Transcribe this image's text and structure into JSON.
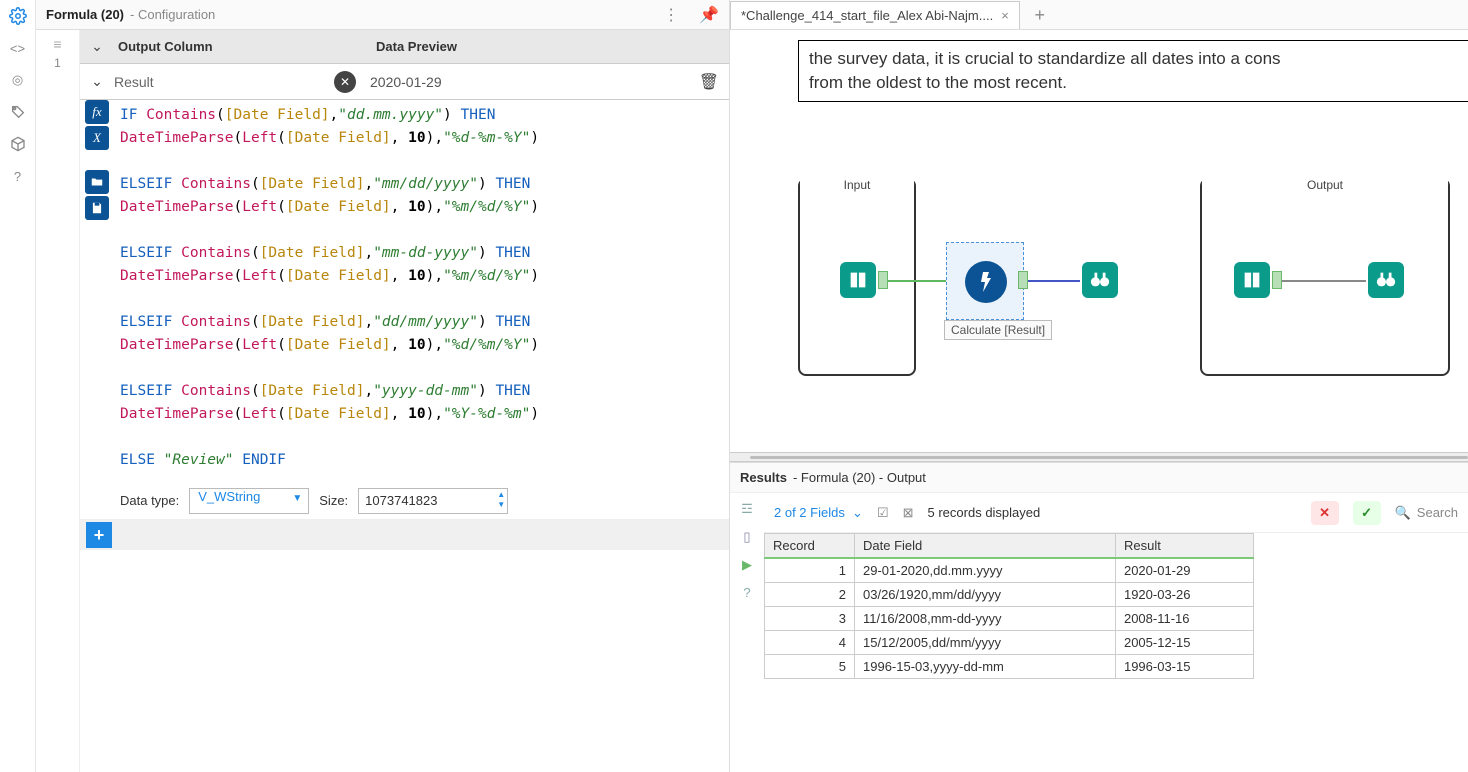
{
  "iconbar": [
    "gear",
    "code",
    "target",
    "tag",
    "cube",
    "help"
  ],
  "panel": {
    "title": "Formula (20)",
    "sub": "- Configuration"
  },
  "config": {
    "line_no": "1",
    "headers": {
      "output": "Output Column",
      "preview": "Data Preview"
    },
    "output_column": "Result",
    "preview_value": "2020-01-29",
    "datatype_label": "Data type:",
    "datatype_value": "V_WString",
    "size_label": "Size:",
    "size_value": "1073741823"
  },
  "tab": {
    "label": "*Challenge_414_start_file_Alex Abi-Najm...."
  },
  "desc_lines": [
    "the survey data, it is crucial to standardize all dates into a cons",
    "from the oldest to the most recent."
  ],
  "containers": {
    "input": "Input",
    "output": "Output"
  },
  "annotation": "Calculate [Result]",
  "results": {
    "title_bold": "Results",
    "title_rest": " - Formula (20) - Output",
    "fields_label": "2 of 2 Fields",
    "records_label": "5 records displayed",
    "search": "Search",
    "columns": [
      "Record",
      "Date Field",
      "Result"
    ],
    "rows": [
      {
        "n": "1",
        "df": "29-01-2020,dd.mm.yyyy",
        "r": "2020-01-29"
      },
      {
        "n": "2",
        "df": "03/26/1920,mm/dd/yyyy",
        "r": "1920-03-26"
      },
      {
        "n": "3",
        "df": "11/16/2008,mm-dd-yyyy",
        "r": "2008-11-16"
      },
      {
        "n": "4",
        "df": "15/12/2005,dd/mm/yyyy",
        "r": "2005-12-15"
      },
      {
        "n": "5",
        "df": "1996-15-03,yyyy-dd-mm",
        "r": "1996-03-15"
      }
    ]
  },
  "formula_text": {
    "l1": {
      "kw1": "IF",
      "fn": "Contains",
      "fld": "[Date Field]",
      "str": "\"dd.mm.yyyy\"",
      "kw2": "THEN"
    },
    "l2": {
      "fn1": "DateTimeParse",
      "fn2": "Left",
      "fld": "[Date Field]",
      "num": "10",
      "str": "\"%d-%m-%Y\""
    },
    "l3": {
      "kw1": "ELSEIF",
      "fn": "Contains",
      "fld": "[Date Field]",
      "str": "\"mm/dd/yyyy\"",
      "kw2": "THEN"
    },
    "l4": {
      "fn1": "DateTimeParse",
      "fn2": "Left",
      "fld": "[Date Field]",
      "num": "10",
      "str": "\"%m/%d/%Y\""
    },
    "l5": {
      "kw1": "ELSEIF",
      "fn": "Contains",
      "fld": "[Date Field]",
      "str": "\"mm-dd-yyyy\"",
      "kw2": "THEN"
    },
    "l6": {
      "fn1": "DateTimeParse",
      "fn2": "Left",
      "fld": "[Date Field]",
      "num": "10",
      "str": "\"%m/%d/%Y\""
    },
    "l7": {
      "kw1": "ELSEIF",
      "fn": "Contains",
      "fld": "[Date Field]",
      "str": "\"dd/mm/yyyy\"",
      "kw2": "THEN"
    },
    "l8": {
      "fn1": "DateTimeParse",
      "fn2": "Left",
      "fld": "[Date Field]",
      "num": "10",
      "str": "\"%d/%m/%Y\""
    },
    "l9": {
      "kw1": "ELSEIF",
      "fn": "Contains",
      "fld": "[Date Field]",
      "str": "\"yyyy-dd-mm\"",
      "kw2": "THEN"
    },
    "l10": {
      "fn1": "DateTimeParse",
      "fn2": "Left",
      "fld": "[Date Field]",
      "num": "10",
      "str": "\"%Y-%d-%m\""
    },
    "l11": {
      "kw1": "ELSE",
      "str": "\"Review\"",
      "kw2": "ENDIF"
    }
  }
}
